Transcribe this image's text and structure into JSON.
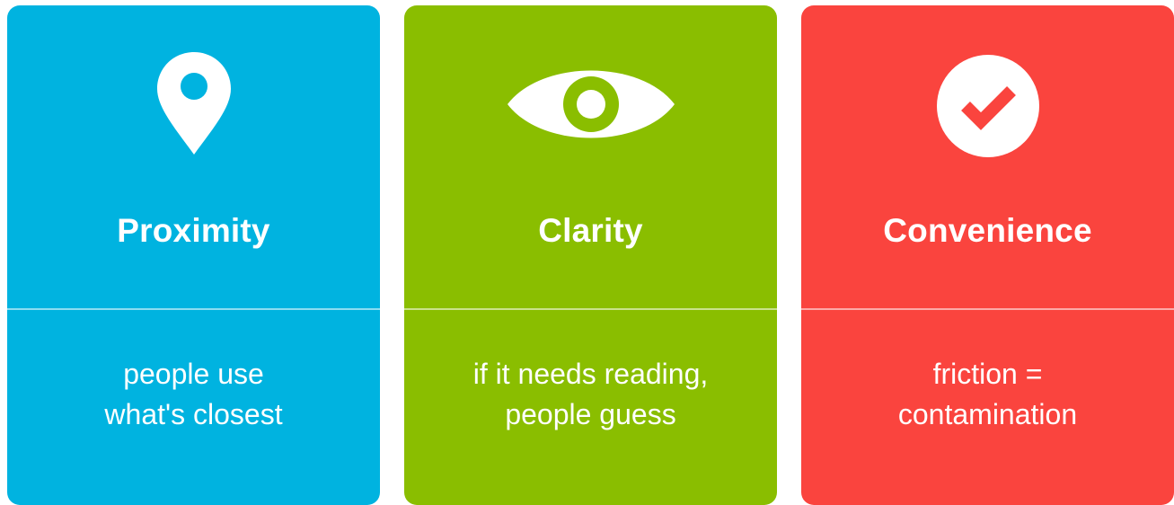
{
  "cards": [
    {
      "title": "Proximity",
      "icon": "map-pin-icon",
      "color": "#00b3e0",
      "lines": [
        "people use",
        "what's closest"
      ]
    },
    {
      "title": "Clarity",
      "icon": "eye-icon",
      "color": "#8abe00",
      "lines": [
        "if it needs reading,",
        "people guess"
      ]
    },
    {
      "title": "Convenience",
      "icon": "check-circle-icon",
      "color": "#fa443e",
      "lines": [
        "friction =",
        "contamination"
      ]
    }
  ]
}
